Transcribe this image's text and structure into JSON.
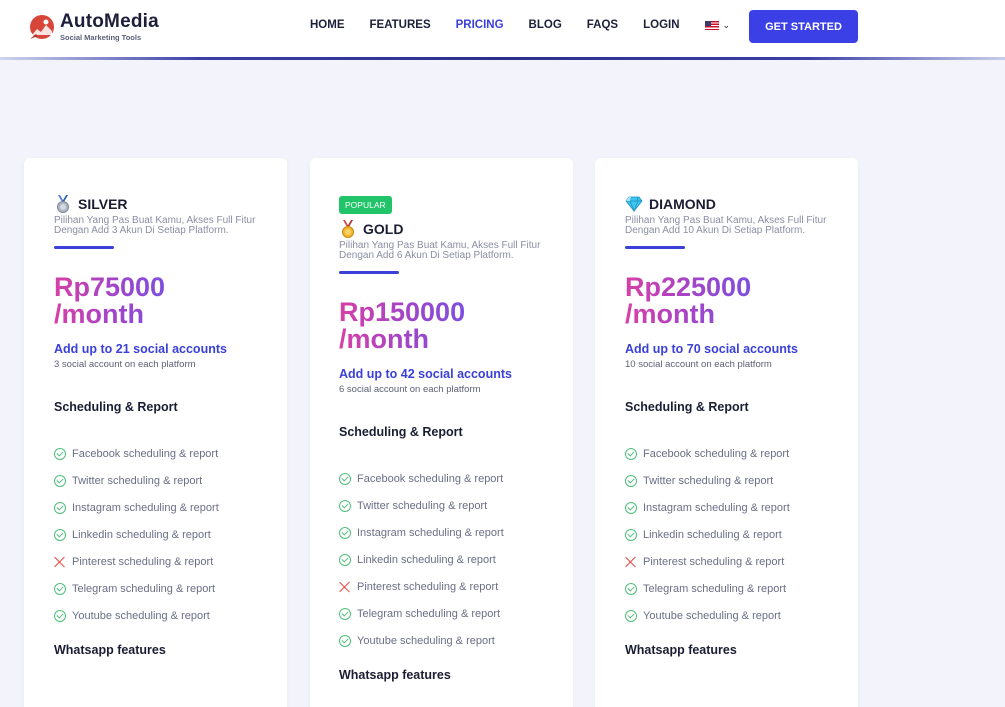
{
  "brand": {
    "name": "AutoMedia",
    "tagline": "Social Marketing Tools"
  },
  "nav": {
    "items": [
      "HOME",
      "FEATURES",
      "PRICING",
      "BLOG",
      "FAQS",
      "LOGIN"
    ],
    "active": "PRICING",
    "language_flag": "us-flag-icon"
  },
  "cta": {
    "label": "GET STARTED"
  },
  "colors": {
    "accent": "#3b40d9",
    "price_gradient_start": "#d83fa6",
    "price_gradient_end": "#7c4fe0",
    "check": "#4fbf7a",
    "cross": "#ef3f3f",
    "badge": "#22c46a"
  },
  "plans": [
    {
      "name": "SILVER",
      "icon": "silver-medal-icon",
      "badge": "",
      "description": "Pilihan Yang Pas Buat Kamu, Akses Full Fitur Dengan Add 3 Akun Di Setiap Platform.",
      "price_line1": "Rp75000",
      "price_line2": "/month",
      "accounts": "Add up to 21 social accounts",
      "accounts_sub": "3 social account on each platform",
      "section_title": "Scheduling & Report",
      "features": [
        {
          "text": "Facebook scheduling & report",
          "included": true
        },
        {
          "text": "Twitter scheduling & report",
          "included": true
        },
        {
          "text": "Instagram scheduling & report",
          "included": true
        },
        {
          "text": "Linkedin scheduling & report",
          "included": true
        },
        {
          "text": "Pinterest scheduling & report",
          "included": false
        },
        {
          "text": "Telegram scheduling & report",
          "included": true
        },
        {
          "text": "Youtube scheduling & report",
          "included": true
        }
      ],
      "whatsapp_title": "Whatsapp features"
    },
    {
      "name": "GOLD",
      "icon": "gold-medal-icon",
      "badge": "POPULAR",
      "description": "Pilihan Yang Pas Buat Kamu, Akses Full Fitur Dengan Add 6 Akun Di Setiap Platform.",
      "price_line1": "Rp150000",
      "price_line2": "/month",
      "accounts": "Add up to 42 social accounts",
      "accounts_sub": "6 social account on each platform",
      "section_title": "Scheduling & Report",
      "features": [
        {
          "text": "Facebook scheduling & report",
          "included": true
        },
        {
          "text": "Twitter scheduling & report",
          "included": true
        },
        {
          "text": "Instagram scheduling & report",
          "included": true
        },
        {
          "text": "Linkedin scheduling & report",
          "included": true
        },
        {
          "text": "Pinterest scheduling & report",
          "included": false
        },
        {
          "text": "Telegram scheduling & report",
          "included": true
        },
        {
          "text": "Youtube scheduling & report",
          "included": true
        }
      ],
      "whatsapp_title": "Whatsapp features"
    },
    {
      "name": "DIAMOND",
      "icon": "diamond-icon",
      "badge": "",
      "description": "Pilihan Yang Pas Buat Kamu, Akses Full Fitur Dengan Add 10 Akun Di Setiap Platform.",
      "price_line1": "Rp225000",
      "price_line2": "/month",
      "accounts": "Add up to 70 social accounts",
      "accounts_sub": "10 social account on each platform",
      "section_title": "Scheduling & Report",
      "features": [
        {
          "text": "Facebook scheduling & report",
          "included": true
        },
        {
          "text": "Twitter scheduling & report",
          "included": true
        },
        {
          "text": "Instagram scheduling & report",
          "included": true
        },
        {
          "text": "Linkedin scheduling & report",
          "included": true
        },
        {
          "text": "Pinterest scheduling & report",
          "included": false
        },
        {
          "text": "Telegram scheduling & report",
          "included": true
        },
        {
          "text": "Youtube scheduling & report",
          "included": true
        }
      ],
      "whatsapp_title": "Whatsapp features"
    }
  ]
}
